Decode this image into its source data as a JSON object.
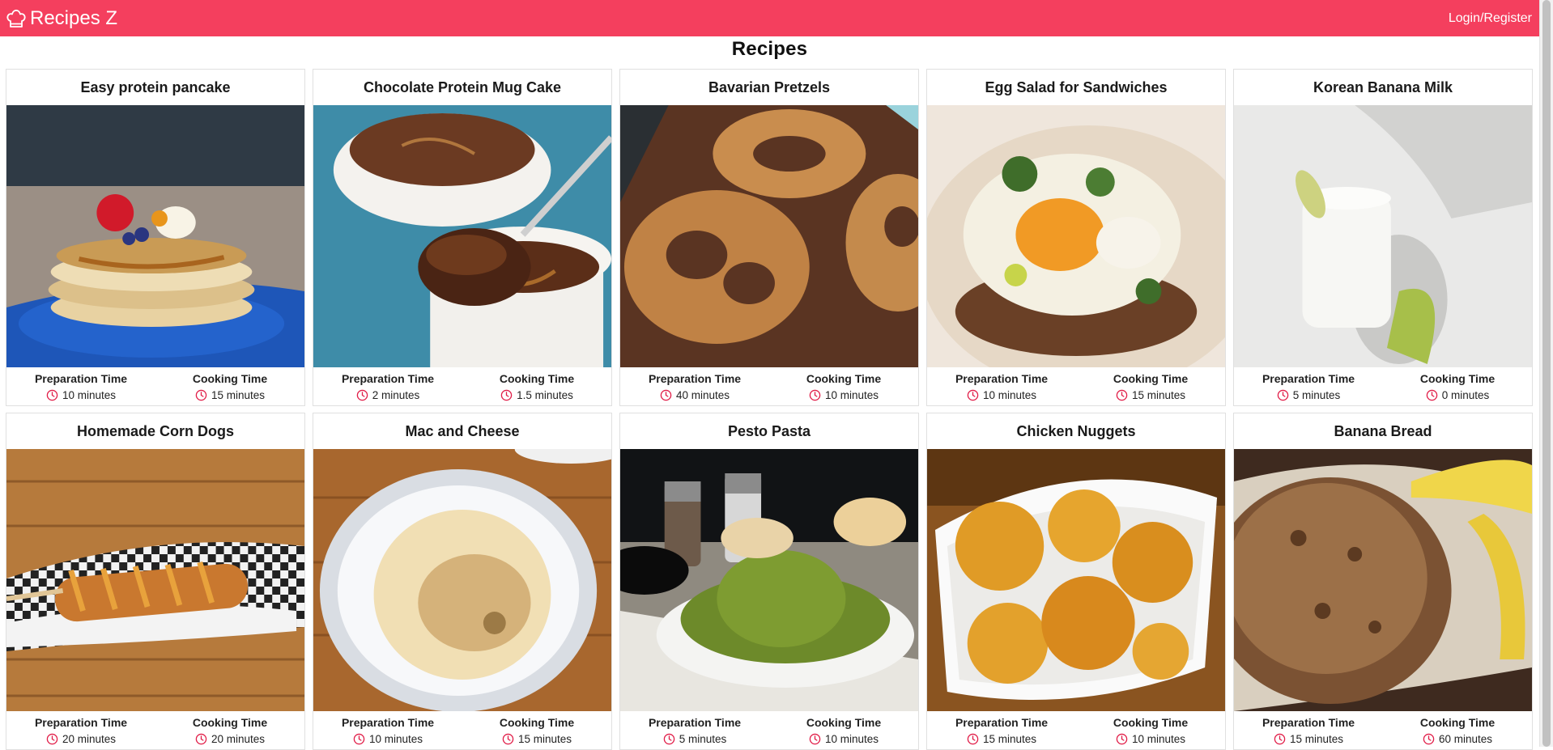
{
  "nav": {
    "brand": "Recipes Z",
    "login": "Login/Register"
  },
  "page": {
    "title": "Recipes"
  },
  "labels": {
    "prep": "Preparation Time",
    "cook": "Cooking Time"
  },
  "colors": {
    "brand": "#f43f5e",
    "clock": "#e11d48"
  },
  "recipes": [
    {
      "title": "Easy protein pancake",
      "prep": "10 minutes",
      "cook": "15 minutes",
      "image": "pancake-photo"
    },
    {
      "title": "Chocolate Protein Mug Cake",
      "prep": "2 minutes",
      "cook": "1.5 minutes",
      "image": "mug-cake-photo"
    },
    {
      "title": "Bavarian Pretzels",
      "prep": "40 minutes",
      "cook": "10 minutes",
      "image": "pretzels-photo"
    },
    {
      "title": "Egg Salad for Sandwiches",
      "prep": "10 minutes",
      "cook": "15 minutes",
      "image": "egg-toast-photo"
    },
    {
      "title": "Korean Banana Milk",
      "prep": "5 minutes",
      "cook": "0 minutes",
      "image": "banana-milk-photo"
    },
    {
      "title": "Homemade Corn Dogs",
      "prep": "20 minutes",
      "cook": "20 minutes",
      "image": "corn-dog-photo"
    },
    {
      "title": "Mac and Cheese",
      "prep": "10 minutes",
      "cook": "15 minutes",
      "image": "mac-cheese-photo"
    },
    {
      "title": "Pesto Pasta",
      "prep": "5 minutes",
      "cook": "10 minutes",
      "image": "pesto-pasta-photo"
    },
    {
      "title": "Chicken Nuggets",
      "prep": "15 minutes",
      "cook": "10 minutes",
      "image": "nuggets-photo"
    },
    {
      "title": "Banana Bread",
      "prep": "15 minutes",
      "cook": "60 minutes",
      "image": "banana-bread-photo"
    }
  ]
}
